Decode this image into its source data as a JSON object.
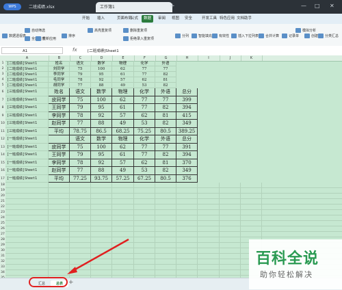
{
  "titlebar": {
    "wps_label": "WPS",
    "file_tab1": "二班成绩.xlsx",
    "file_tab2": "工作簿1",
    "plus": "+",
    "win_min": "—",
    "win_max": "□",
    "win_close": "✕"
  },
  "menu": [
    "开始",
    "插入",
    "页面布局",
    "公式",
    "数据",
    "审阅",
    "视图",
    "安全",
    "开发工具",
    "特色应用",
    "文档助手"
  ],
  "active_menu": "数据",
  "ribbon": [
    "数据透视表",
    "自动筛选",
    "全部显示",
    "重新应用",
    "排序",
    "高亮重复项",
    "删除重复项",
    "拒绝录入重复项",
    "分列",
    "智能填充",
    "有效性",
    "插入下拉列表",
    "合并计算",
    "记录单",
    "模拟分析",
    "创建组",
    "分类汇总"
  ],
  "formula": {
    "namebox": "A1",
    "fx": "fx",
    "content": "[二班成绩]Sheet1"
  },
  "columns": [
    "A",
    "B",
    "C",
    "D",
    "E",
    "F",
    "G",
    "H",
    "I",
    "J",
    "K"
  ],
  "rows": [
    "1",
    "2",
    "3",
    "4",
    "5",
    "6",
    "7",
    "8",
    "9",
    "10",
    "11",
    "12",
    "13",
    "14",
    "15",
    "16",
    "17",
    "18",
    "19",
    "20",
    "21",
    "22",
    "23",
    "24",
    "25",
    "26",
    "27",
    "28",
    "29",
    "30",
    "31",
    "32",
    "33",
    "34",
    "35",
    "36"
  ],
  "source_label": "[二班成绩]Sheet1",
  "sheet_rows": [
    [
      "[二班成绩]Sheet1",
      "姓名",
      "语文",
      "数学",
      "物理",
      "化学",
      "外语"
    ],
    [
      "[二班成绩]Sheet1",
      "刘同学",
      "75",
      "100",
      "62",
      "77",
      "77"
    ],
    [
      "[二班成绩]Sheet1",
      "李同学",
      "79",
      "95",
      "61",
      "77",
      "82"
    ],
    [
      "[二班成绩]Sheet1",
      "毛同学",
      "78",
      "92",
      "57",
      "62",
      "81"
    ],
    [
      "[二班成绩]Sheet1",
      "胡同学",
      "77",
      "88",
      "49",
      "53",
      "82"
    ],
    [
      "[三班成绩]Sheet1",
      "姓名",
      "语文",
      "数学",
      "物理",
      "化学",
      "外语",
      "总分"
    ],
    [
      "[三班成绩]Sheet1",
      "皮同学",
      "75",
      "100",
      "62",
      "77",
      "77",
      "399"
    ],
    [
      "[三班成绩]Sheet1",
      "王同学",
      "79",
      "95",
      "61",
      "77",
      "82",
      "394"
    ],
    [
      "[三班成绩]Sheet1",
      "李同学",
      "78",
      "92",
      "57",
      "62",
      "81",
      "415"
    ],
    [
      "[三班成绩]Sheet1",
      "赵同学",
      "77",
      "88",
      "49",
      "53",
      "82",
      "349"
    ],
    [
      "[三班成绩]Sheet1",
      "平均",
      "78.75",
      "86.5",
      "68.25",
      "75.25",
      "80.5",
      "389.25"
    ],
    [
      "[一班成绩]Sheet1",
      "",
      "语文",
      "数学",
      "物理",
      "化学",
      "外语",
      "总分"
    ],
    [
      "[一班成绩]Sheet1",
      "皮同学",
      "75",
      "100",
      "62",
      "77",
      "77",
      "391"
    ],
    [
      "[一班成绩]Sheet1",
      "王同学",
      "79",
      "95",
      "61",
      "77",
      "82",
      "394"
    ],
    [
      "[一班成绩]Sheet1",
      "李同学",
      "78",
      "92",
      "57",
      "62",
      "81",
      "370"
    ],
    [
      "[一班成绩]Sheet1",
      "赵同学",
      "77",
      "88",
      "49",
      "53",
      "82",
      "349"
    ],
    [
      "[一班成绩]Sheet1",
      "平均",
      "77.25",
      "93.75",
      "57.25",
      "67.25",
      "80.5",
      "376"
    ]
  ],
  "sheets": [
    "汇总",
    "总表"
  ],
  "active_sheet": "总表",
  "add_sheet": "+",
  "watermark": {
    "big": "百科全说",
    "small": "助你轻松解决"
  },
  "colors": {
    "accent": "#2b7b3c",
    "highlight": "#e02020",
    "grid_bg": "#c6e8d1"
  }
}
